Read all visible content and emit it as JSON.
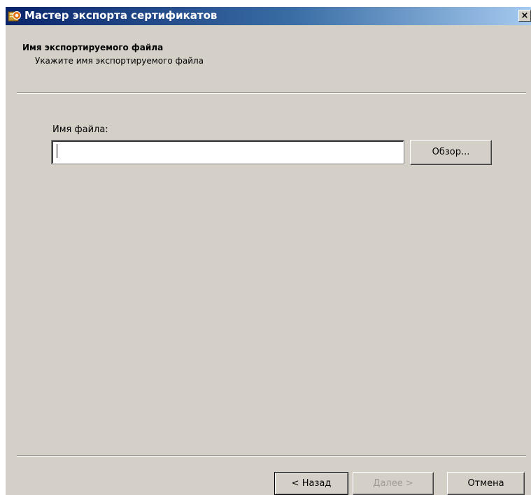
{
  "window": {
    "title": "Мастер экспорта сертификатов",
    "icon": "certificate-wizard-icon",
    "close_label": "×"
  },
  "header": {
    "title": "Имя экспортируемого файла",
    "subtitle": "Укажите имя экспортируемого файла"
  },
  "form": {
    "file_label": "Имя файла:",
    "file_value": "",
    "browse_label": "Обзор..."
  },
  "footer": {
    "back_label": "< Назад",
    "next_label": "Далее >",
    "cancel_label": "Отмена"
  },
  "colors": {
    "dialog_bg": "#d4d0c8",
    "titlebar_start": "#0a246a",
    "titlebar_end": "#a6caf0",
    "disabled_text": "#a09c94"
  }
}
